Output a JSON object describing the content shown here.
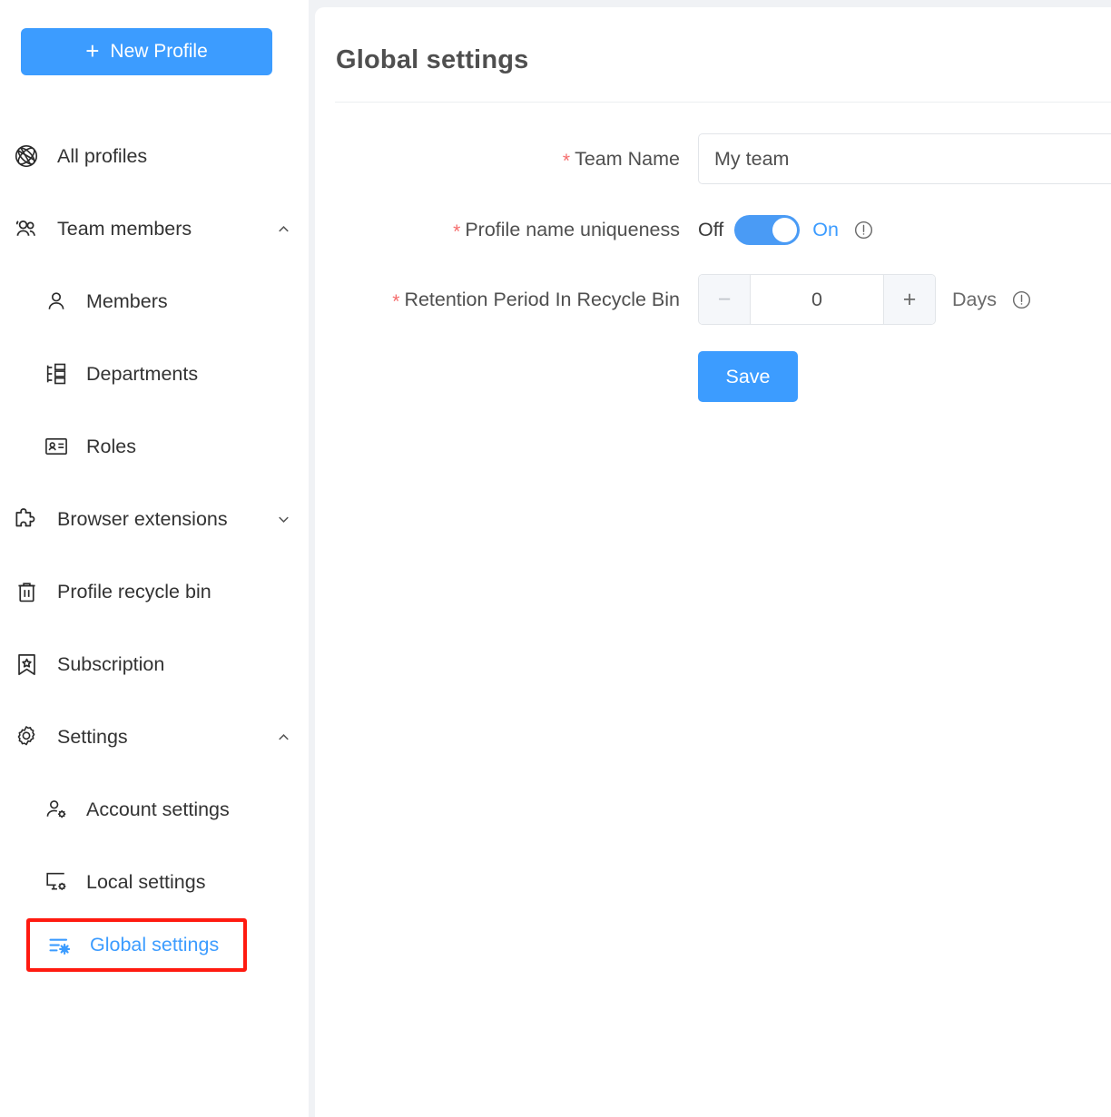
{
  "sidebar": {
    "new_profile_button": {
      "label": "New Profile",
      "icon": "plus-icon",
      "color": "#3c9cff"
    },
    "items": [
      {
        "label": "All profiles",
        "icon": "globe-icon",
        "level": 0,
        "chevron": "",
        "active": false
      },
      {
        "label": "Team members",
        "icon": "people-icon",
        "level": 0,
        "chevron": "chevron-up-icon",
        "active": false
      },
      {
        "label": "Members",
        "icon": "person-icon",
        "level": 1,
        "chevron": "",
        "active": false
      },
      {
        "label": "Departments",
        "icon": "org-chart-icon",
        "level": 1,
        "chevron": "",
        "active": false
      },
      {
        "label": "Roles",
        "icon": "id-card-icon",
        "level": 1,
        "chevron": "",
        "active": false
      },
      {
        "label": "Browser extensions",
        "icon": "puzzle-piece-icon",
        "level": 0,
        "chevron": "chevron-down-icon",
        "active": false
      },
      {
        "label": "Profile recycle bin",
        "icon": "trash-icon",
        "level": 0,
        "chevron": "",
        "active": false
      },
      {
        "label": "Subscription",
        "icon": "bookmark-star-icon",
        "level": 0,
        "chevron": "",
        "active": false
      },
      {
        "label": "Settings",
        "icon": "gear-icon",
        "level": 0,
        "chevron": "chevron-up-icon",
        "active": false
      },
      {
        "label": "Account settings",
        "icon": "person-gear-icon",
        "level": 1,
        "chevron": "",
        "active": false
      },
      {
        "label": "Local settings",
        "icon": "monitor-gear-icon",
        "level": 1,
        "chevron": "",
        "active": false
      },
      {
        "label": "Global settings",
        "icon": "sliders-gear-icon",
        "level": 1,
        "chevron": "",
        "active": true,
        "highlight_color": "#ff1a10"
      }
    ]
  },
  "main": {
    "title": "Global settings",
    "form": {
      "team_name": {
        "label": "Team Name",
        "required_marker": "*",
        "value": "My team",
        "placeholder": "Team Name"
      },
      "profile_name_uniqueness": {
        "label": "Profile name uniqueness",
        "required_marker": "*",
        "off_label": "Off",
        "on_label": "On",
        "state": "On",
        "info_icon": "info-circle-icon"
      },
      "retention_period": {
        "label": "Retention Period In Recycle Bin",
        "required_marker": "*",
        "value": "0",
        "decrement_label": "−",
        "increment_label": "+",
        "unit_label": "Days",
        "info_icon": "info-circle-icon"
      },
      "save_button": {
        "label": "Save"
      }
    }
  },
  "colors": {
    "accent": "#3c9cff",
    "toggle_on": "#4a9bf5",
    "required": "#f56c6c",
    "highlight": "#ff1a10",
    "page_bg": "#f0f2f5"
  }
}
